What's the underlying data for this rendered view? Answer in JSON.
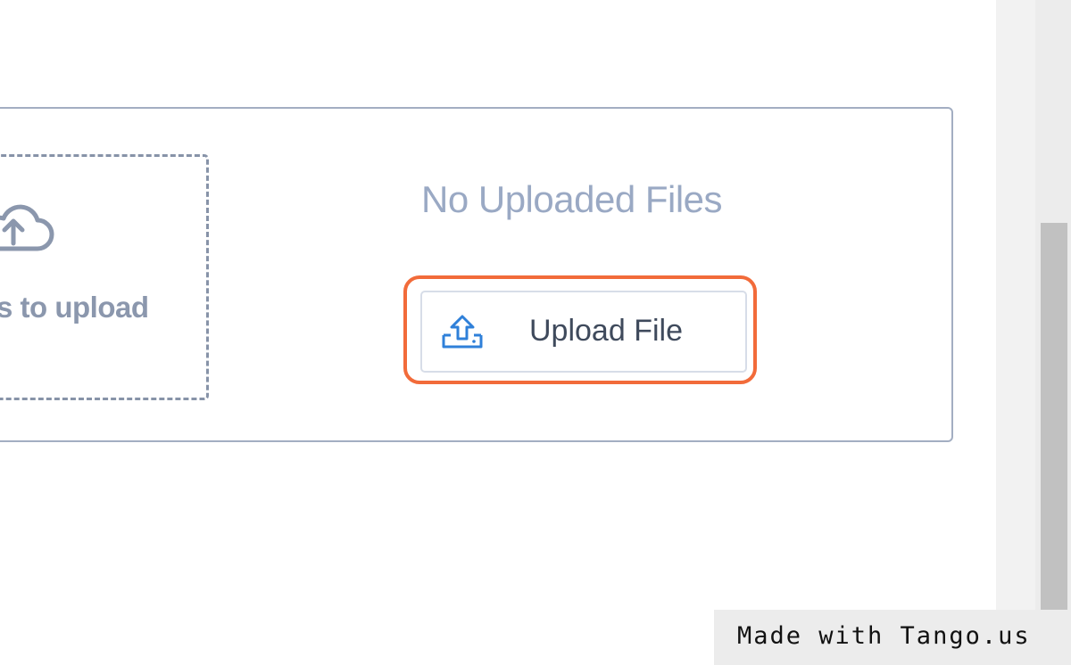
{
  "dropzone": {
    "icon": "cloud-upload-icon",
    "text": "s to upload"
  },
  "files_panel": {
    "empty_title": "No Uploaded Files",
    "upload_button": {
      "label": "Upload File",
      "icon": "tray-upload-icon"
    }
  },
  "highlight_color": "#f26b3a",
  "accent_color": "#2f80d9",
  "watermark": {
    "text": "Made with Tango.us"
  }
}
